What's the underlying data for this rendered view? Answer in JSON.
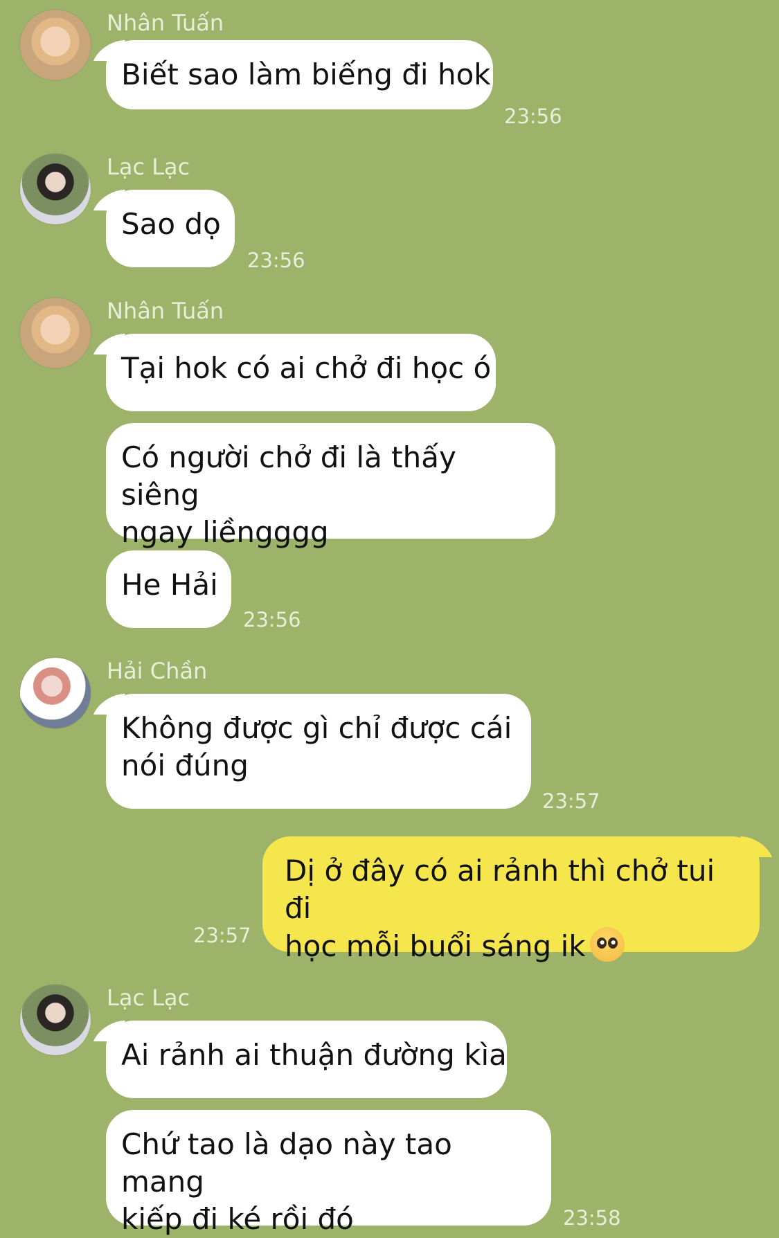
{
  "messages": [
    {
      "sender": "Nhân Tuấn",
      "avatar": "avatar-nhan-tuan",
      "texts": [
        "Biết sao làm biếng đi hok"
      ],
      "time": "23:56"
    },
    {
      "sender": "Lạc Lạc",
      "avatar": "avatar-lac-lac",
      "texts": [
        "Sao dọ"
      ],
      "time": "23:56"
    },
    {
      "sender": "Nhân Tuấn",
      "avatar": "avatar-nhan-tuan",
      "texts": [
        "Tại hok có ai chở đi học ó",
        "Có người chở đi là thấy siêng\nngay liềngggg",
        "He Hải"
      ],
      "time": "23:56"
    },
    {
      "sender": "Hải Chần",
      "avatar": "avatar-hai-chan",
      "texts": [
        "Không được gì chỉ được cái\nnói đúng"
      ],
      "time": "23:57"
    },
    {
      "sender": "me",
      "texts": [
        "Dị ở đây có ai rảnh thì chở tui đi\nhọc mỗi buổi sáng ik"
      ],
      "emoji": "pleading-face-emoji",
      "time": "23:57"
    },
    {
      "sender": "Lạc Lạc",
      "avatar": "avatar-lac-lac",
      "texts": [
        "Ai rảnh ai thuận đường kìa",
        "Chứ tao là dạo này tao mang\nkiếp đi ké rồi đó"
      ],
      "time": "23:58"
    }
  ],
  "colors": {
    "background": "#9eb36a",
    "incoming_bubble": "#ffffff",
    "outgoing_bubble": "#f6e64d",
    "meta_text": "#e8eed8"
  }
}
